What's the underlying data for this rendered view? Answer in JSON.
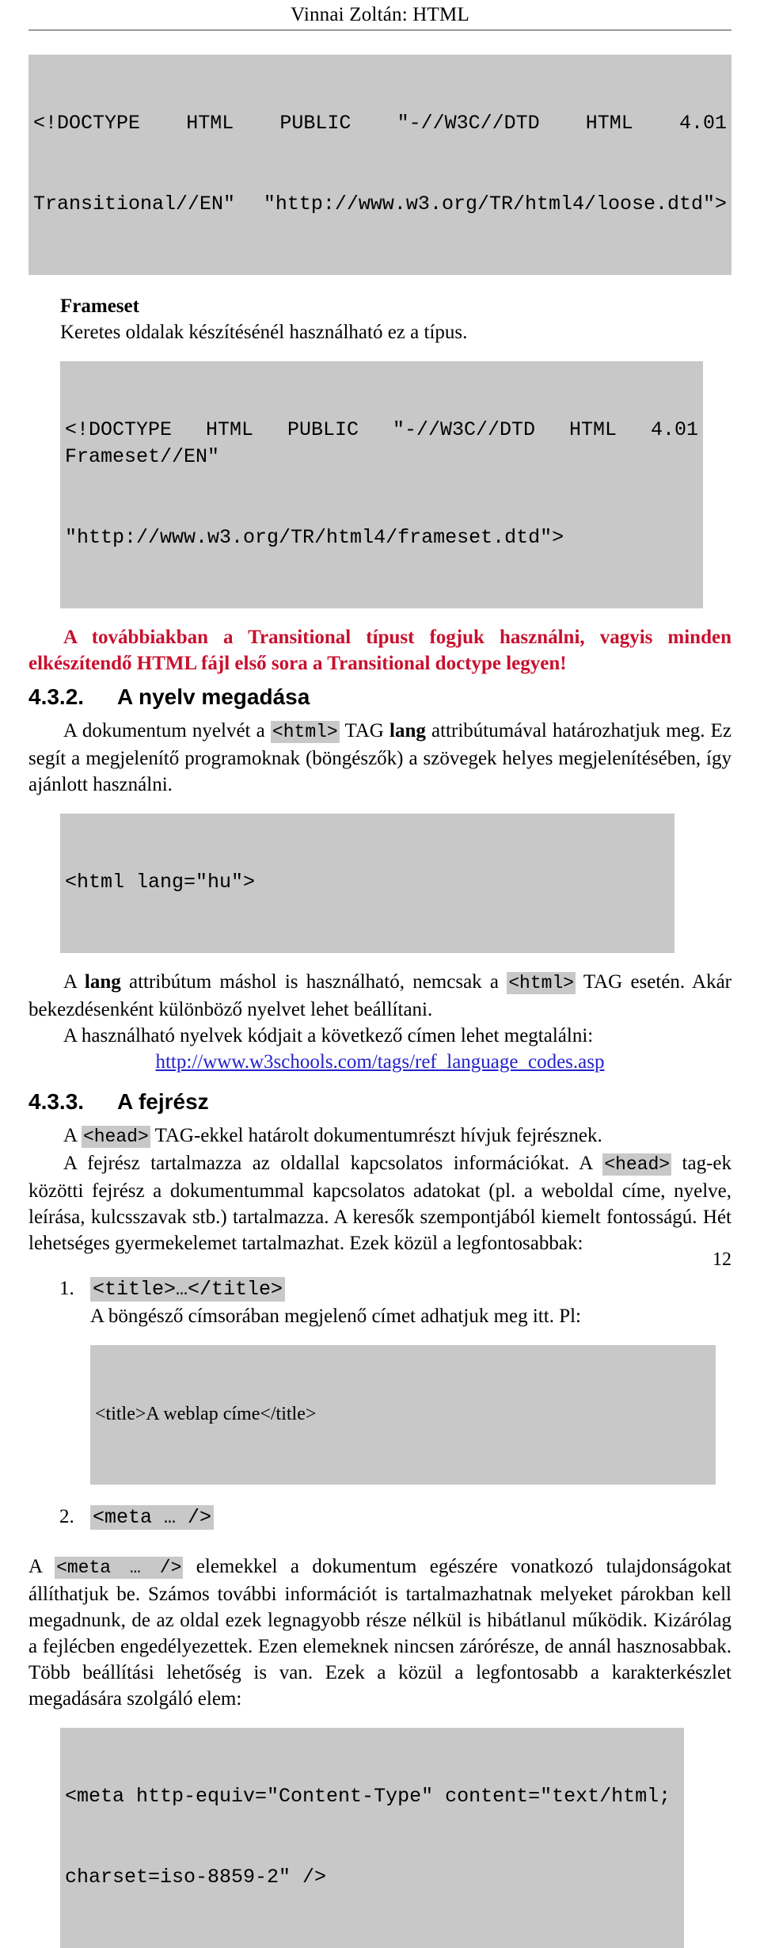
{
  "header": {
    "title": "Vinnai Zoltán: HTML"
  },
  "blocks": {
    "doctype_transitional": {
      "line1": "<!DOCTYPE   HTML   PUBLIC   \"-//W3C//DTD   HTML   4.01",
      "line2": "Transitional//EN\" \"http://www.w3.org/TR/html4/loose.dtd\">"
    },
    "frameset_heading": "Frameset",
    "frameset_desc": "Keretes oldalak készítésénél használható ez a típus.",
    "doctype_frameset": {
      "line1": "<!DOCTYPE HTML PUBLIC \"-//W3C//DTD HTML 4.01 Frameset//EN\"",
      "line2": "\"http://www.w3.org/TR/html4/frameset.dtd\">"
    },
    "red_note": "A továbbiakban a Transitional típust fogjuk használni, vagyis minden elkészítendő HTML fájl első sora a Transitional doctype legyen!"
  },
  "section_432": {
    "number": "4.3.2.",
    "title": "A nyelv megadása",
    "para1_a": "A dokumentum nyelvét a ",
    "para1_code": "<html>",
    "para1_b": " TAG ",
    "para1_bold": "lang",
    "para1_c": " attribútumával határozhatjuk meg. Ez segít a megjelenítő programoknak (böngészők) a szövegek helyes megjelenítésében, így ajánlott használni.",
    "code_html_lang": "<html lang=\"hu\">",
    "para2_a": "A ",
    "para2_bold": "lang",
    "para2_b": " attribútum máshol is használható, nemcsak a ",
    "para2_code": "<html>",
    "para2_c": " TAG esetén. Akár bekezdésenként különböző nyelvet lehet beállítani.",
    "para3": "A használható nyelvek kódjait a következő címen lehet megtalálni:",
    "link": "http://www.w3schools.com/tags/ref_language_codes.asp"
  },
  "section_433": {
    "number": "4.3.3.",
    "title": "A fejrész",
    "para1_a": "A ",
    "para1_code": "<head>",
    "para1_b": " TAG-ekkel határolt dokumentumrészt hívjuk fejrésznek.",
    "para2_a": "A fejrész tartalmazza az oldallal kapcsolatos információkat. A ",
    "para2_code": "<head>",
    "para2_b": " tag-ek közötti fejrész a dokumentummal kapcsolatos adatokat (pl. a weboldal címe, nyelve, leírása, kulcsszavak stb.) tartalmazza. A keresők szempontjából kiemelt fontosságú. Hét lehetséges gyermekelemet tartalmazhat. Ezek közül a legfontosabbak:",
    "list": [
      {
        "code": "<title>…</title>",
        "desc": "A böngésző címsorában megjelenő címet adhatjuk meg itt. Pl:",
        "example": "<title>A weblap címe</title>"
      },
      {
        "code": "<meta … />",
        "desc": "",
        "example": ""
      }
    ],
    "meta_para_a": "A ",
    "meta_para_code": "<meta … />",
    "meta_para_b": " elemekkel a dokumentum egészére vonatkozó tulajdonságokat állíthatjuk be. Számos további információt is tartalmazhatnak melyeket párokban kell megadnunk, de az oldal ezek legnagyobb része nélkül is hibátlanul működik. Kizárólag a fejlécben engedélyezettek. Ezen elemeknek nincsen zárórésze, de annál hasznosabbak. Több beállítási lehetőség is van. Ezek a közül a legfontosabb a karakterkészlet megadására szolgáló elem:",
    "meta_code_block": {
      "line1": "<meta http-equiv=\"Content-Type\" content=\"text/html;",
      "line2": "charset=iso-8859-2\" />"
    }
  },
  "footer": {
    "page_number": "12"
  },
  "colors": {
    "code_background": "#c8c8c8",
    "accent_red": "#c8102e",
    "link_blue": "#2222cc",
    "rule_gray": "#9a9a9a"
  }
}
